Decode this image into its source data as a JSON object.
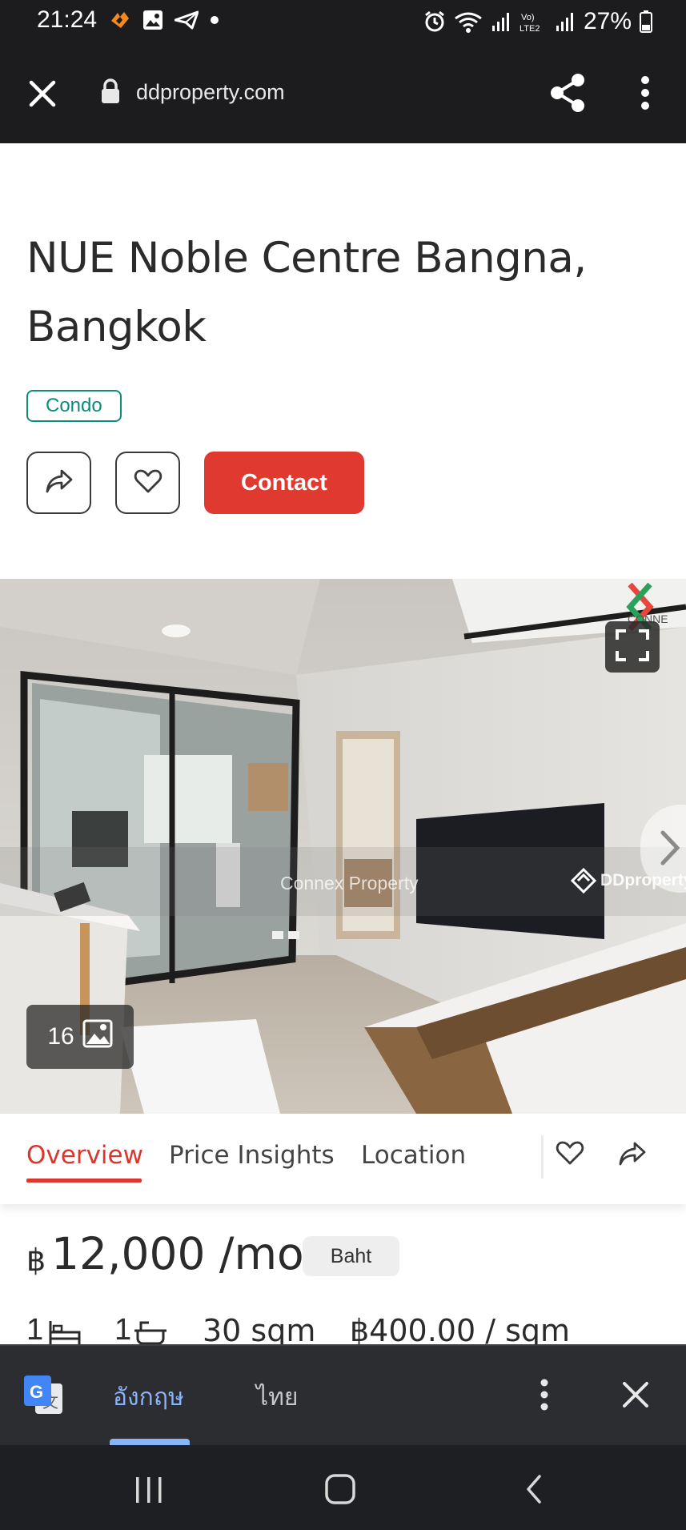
{
  "status_bar": {
    "time": "21:24",
    "battery_percent": "27%",
    "left_icons": [
      "flame-app-icon",
      "image-icon",
      "send-icon",
      "dot-icon"
    ],
    "right_icons": [
      "alarm-icon",
      "wifi-icon",
      "signal-icon",
      "volte-icon",
      "signal-icon",
      "battery-icon"
    ]
  },
  "browser": {
    "url": "ddproperty.com"
  },
  "listing": {
    "title": "NUE Noble Centre Bangna, Bangkok",
    "property_type": "Condo",
    "contact_label": "Contact",
    "photo_count": "16",
    "watermark_text": "Connex Property",
    "watermark_brand": "DDproperty"
  },
  "tabs": [
    {
      "label": "Overview",
      "active": true
    },
    {
      "label": "Price Insights",
      "active": false
    },
    {
      "label": "Location",
      "active": false
    }
  ],
  "price": {
    "currency_symbol": "฿",
    "amount_period": "12,000 /mo",
    "unit_badge": "Baht"
  },
  "specs": {
    "beds": "1",
    "baths": "1",
    "area": "30 sqm",
    "price_per_area": "฿400.00 / sqm"
  },
  "translate_bar": {
    "language_source": "อังกฤษ",
    "language_target": "ไทย"
  },
  "colors": {
    "accent_red": "#e03a30",
    "tag_teal": "#0e8a7e",
    "translate_blue": "#8ab4f8"
  }
}
